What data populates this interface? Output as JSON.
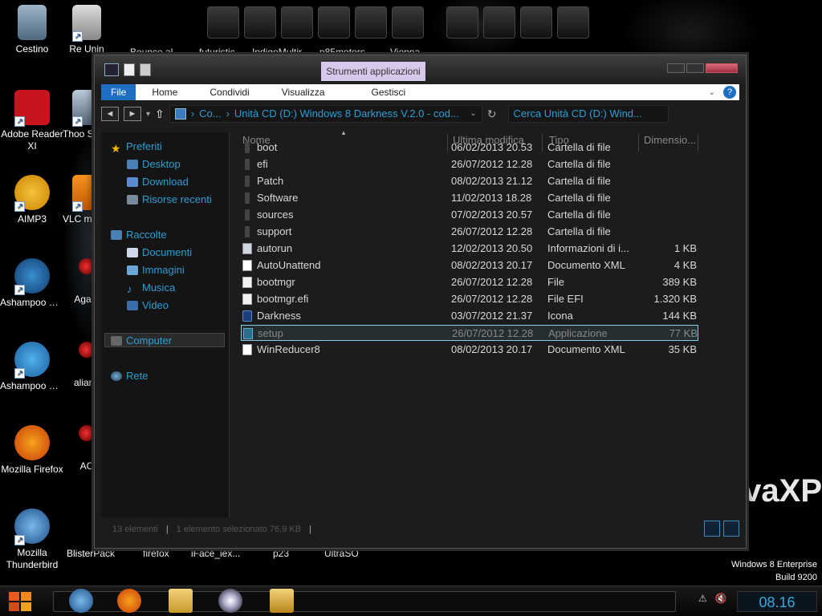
{
  "desktop": {
    "icons": [
      {
        "label": "Cestino"
      },
      {
        "label": "Adobe Reader XI"
      },
      {
        "label": "AIMP3"
      },
      {
        "label": "Ashampoo Burning ..."
      },
      {
        "label": "Ashampoo Burning ..."
      },
      {
        "label": "Mozilla Firefox"
      },
      {
        "label": "Mozilla Thunderbird"
      },
      {
        "label": "Re Unin"
      },
      {
        "label": "Thoo Sideba"
      },
      {
        "label": "VLC m play"
      },
      {
        "label": "Agam"
      },
      {
        "label": "alianb"
      },
      {
        "label": "AC"
      },
      {
        "label": "BlisterPack"
      },
      {
        "label": "firefox"
      },
      {
        "label": "iFace_iex..."
      },
      {
        "label": "p23"
      },
      {
        "label": "UltraSO"
      }
    ],
    "dock_labels": [
      "Bounce al",
      "futuristic",
      "IndigoMultir",
      "p85motors",
      "Vienna"
    ],
    "brand_text": "vaXP",
    "os_version_line1": "Windows 8 Enterprise",
    "os_version_line2": "Build 9200"
  },
  "window": {
    "context_tab": "Strumenti applicazioni",
    "ribbon_tabs": {
      "file": "File",
      "home": "Home",
      "share": "Condividi",
      "view": "Visualizza",
      "manage": "Gestisci"
    },
    "address": {
      "crumb1": "Co...",
      "crumb2": "Unità CD (D:) Windows 8 Darkness V.2.0 - cod..."
    },
    "search_placeholder": "Cerca Unità CD (D:) Wind...",
    "nav": {
      "favorites": "Preferiti",
      "desktop": "Desktop",
      "download": "Download",
      "recent": "Risorse recenti",
      "libraries": "Raccolte",
      "documents": "Documenti",
      "pictures": "Immagini",
      "music": "Musica",
      "video": "Video",
      "computer": "Computer",
      "network": "Rete"
    },
    "columns": {
      "name": "Nome",
      "modified": "Ultima modifica",
      "type": "Tipo",
      "size": "Dimensio..."
    },
    "files": [
      {
        "name": "boot",
        "date": "06/02/2013 20.53",
        "type": "Cartella di file",
        "size": "",
        "icon": "folder"
      },
      {
        "name": "efi",
        "date": "26/07/2012 12.28",
        "type": "Cartella di file",
        "size": "",
        "icon": "folder"
      },
      {
        "name": "Patch",
        "date": "08/02/2013 21.12",
        "type": "Cartella di file",
        "size": "",
        "icon": "folder"
      },
      {
        "name": "Software",
        "date": "11/02/2013 18.28",
        "type": "Cartella di file",
        "size": "",
        "icon": "folder"
      },
      {
        "name": "sources",
        "date": "07/02/2013 20.57",
        "type": "Cartella di file",
        "size": "",
        "icon": "folder"
      },
      {
        "name": "support",
        "date": "26/07/2012 12.28",
        "type": "Cartella di file",
        "size": "",
        "icon": "folder"
      },
      {
        "name": "autorun",
        "date": "12/02/2013 20.50",
        "type": "Informazioni di i...",
        "size": "1 KB",
        "icon": "cfg"
      },
      {
        "name": "AutoUnattend",
        "date": "08/02/2013 20.17",
        "type": "Documento XML",
        "size": "4 KB",
        "icon": "xml"
      },
      {
        "name": "bootmgr",
        "date": "26/07/2012 12.28",
        "type": "File",
        "size": "389 KB",
        "icon": "file"
      },
      {
        "name": "bootmgr.efi",
        "date": "26/07/2012 12.28",
        "type": "File EFI",
        "size": "1.320 KB",
        "icon": "file"
      },
      {
        "name": "Darkness",
        "date": "03/07/2012 21.37",
        "type": "Icona",
        "size": "144 KB",
        "icon": "ico"
      },
      {
        "name": "setup",
        "date": "26/07/2012 12.28",
        "type": "Applicazione",
        "size": "77 KB",
        "icon": "app"
      },
      {
        "name": "WinReducer8",
        "date": "08/02/2013 20.17",
        "type": "Documento XML",
        "size": "35 KB",
        "icon": "xml"
      }
    ],
    "status": {
      "count": "13 elementi",
      "selection": "1 elemento selezionato 76,9 KB"
    }
  },
  "taskbar": {
    "clock": "08.16"
  }
}
